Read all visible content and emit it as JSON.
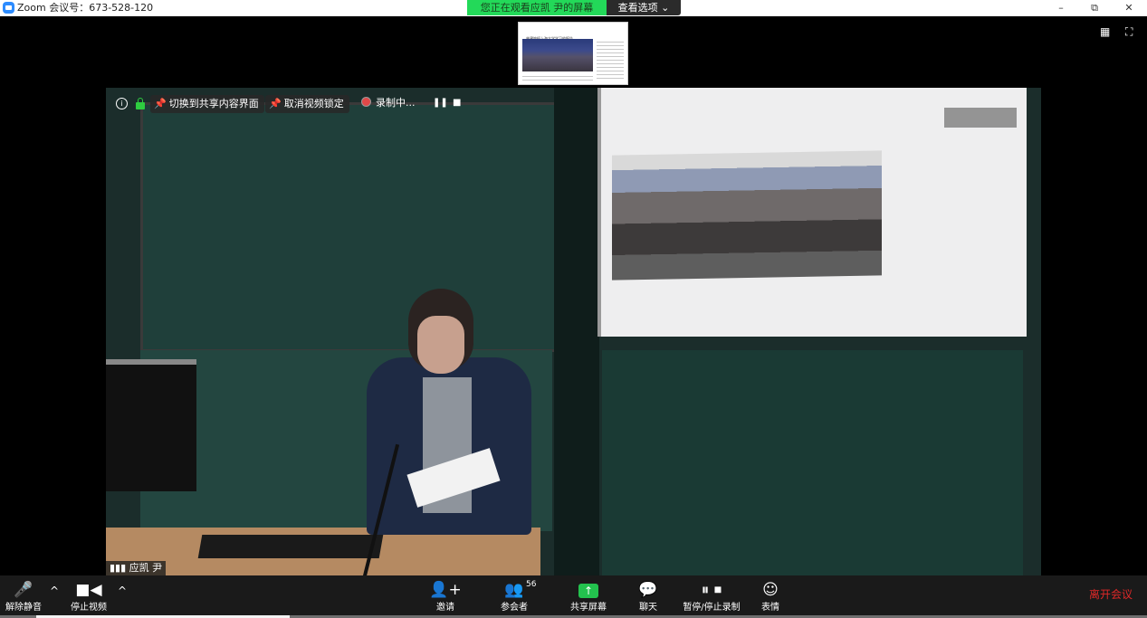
{
  "window": {
    "title": "Zoom 会议号：673-528-120",
    "controls": {
      "minimize": "–",
      "restore": "⧉",
      "close": "✕"
    }
  },
  "share_banner": {
    "text": "您正在观看应凯 尹的屏幕",
    "view_options": "查看选项 ⌄",
    "color": "#23d959"
  },
  "thumbnail": {
    "header": "林建筑桓上海大学学习的报告"
  },
  "video_overlay": {
    "switch_to_share": "切换到共享内容界面",
    "unlock_video": "取消视频锁定",
    "recording": "录制中...",
    "pause_icon": "❚❚",
    "stop_icon": "■"
  },
  "participant_name": "应凯 尹",
  "toolbar": {
    "unmute": "解除静音",
    "stop_video": "停止视频",
    "invite": "邀请",
    "participants": "参会者",
    "participants_count": "56",
    "share_screen": "共享屏幕",
    "chat": "聊天",
    "pause_stop_record": "暂停/停止录制",
    "reactions": "表情",
    "leave": "离开会议"
  },
  "icons": {
    "mic_muted": "mic-muted-icon",
    "camera": "camera-icon",
    "add_user": "add-user-icon",
    "participants": "participants-icon",
    "share": "share-icon",
    "chat": "chat-icon",
    "pause": "pause-icon",
    "stop": "stop-icon",
    "reaction": "reaction-icon"
  },
  "colors": {
    "leave": "#e02828",
    "share_button": "#23c24e",
    "toolbar_bg": "#1a1a1a"
  }
}
